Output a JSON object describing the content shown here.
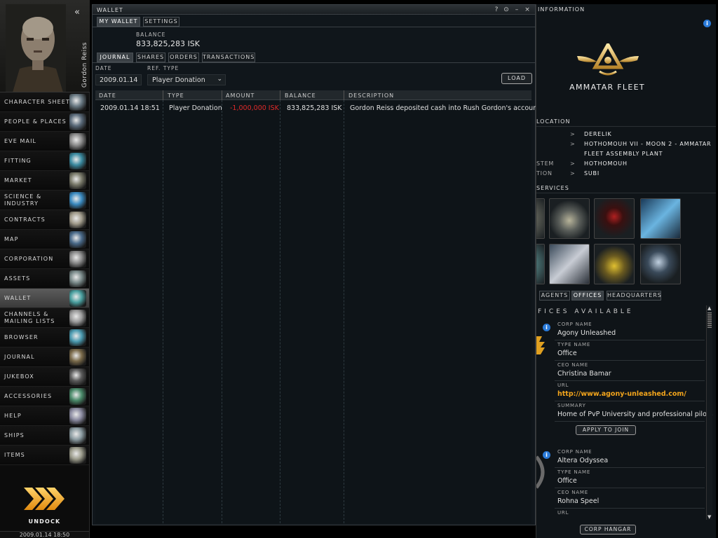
{
  "sidebar": {
    "character_name": "Gordon Reiss",
    "items": [
      {
        "label": "CHARACTER SHEET",
        "icon": "character-sheet-icon"
      },
      {
        "label": "PEOPLE & PLACES",
        "icon": "people-places-icon"
      },
      {
        "label": "EVE MAIL",
        "icon": "mail-icon"
      },
      {
        "label": "FITTING",
        "icon": "fitting-icon"
      },
      {
        "label": "MARKET",
        "icon": "market-icon"
      },
      {
        "label": "SCIENCE &",
        "label2": "INDUSTRY",
        "icon": "science-industry-icon"
      },
      {
        "label": "CONTRACTS",
        "icon": "contracts-icon"
      },
      {
        "label": "MAP",
        "icon": "map-icon"
      },
      {
        "label": "CORPORATION",
        "icon": "corporation-icon"
      },
      {
        "label": "ASSETS",
        "icon": "assets-icon"
      },
      {
        "label": "WALLET",
        "icon": "wallet-icon"
      },
      {
        "label": "CHANNELS &",
        "label2": "MAILING LISTS",
        "icon": "channels-icon"
      },
      {
        "label": "BROWSER",
        "icon": "browser-icon"
      },
      {
        "label": "JOURNAL",
        "icon": "journal-icon"
      },
      {
        "label": "JUKEBOX",
        "icon": "jukebox-icon"
      },
      {
        "label": "ACCESSORIES",
        "icon": "accessories-icon"
      },
      {
        "label": "HELP",
        "icon": "help-icon"
      },
      {
        "label": "SHIPS",
        "icon": "ships-icon"
      },
      {
        "label": "ITEMS",
        "icon": "items-icon"
      }
    ],
    "active_index": 10,
    "undock_label": "UNDOCK",
    "clock": "2009.01.14  18:50"
  },
  "wallet": {
    "title": "WALLET",
    "tabs": [
      "MY WALLET",
      "SETTINGS"
    ],
    "balance_label": "BALANCE",
    "balance_value": "833,825,283 ISK",
    "subtabs": [
      "JOURNAL",
      "SHARES",
      "ORDERS",
      "TRANSACTIONS"
    ],
    "date_label": "DATE",
    "ref_type_label": "REF. TYPE",
    "date_value": "2009.01.14",
    "ref_type_value": "Player Donation",
    "load_label": "LOAD",
    "columns": [
      "DATE",
      "TYPE",
      "AMOUNT",
      "BALANCE",
      "DESCRIPTION"
    ],
    "rows": [
      {
        "date": "2009.01.14 18:51",
        "type": "Player Donation",
        "amount": "-1,000,000 ISK",
        "balance": "833,825,283 ISK",
        "description": "Gordon Reiss deposited cash into Rush Gordon's account"
      }
    ]
  },
  "info": {
    "title": "INFORMATION",
    "corp_name": "AMMATAR FLEET",
    "location_header": "LOCATION",
    "location": [
      {
        "key": "",
        "value": "DERELIK"
      },
      {
        "key": "",
        "value": "HOTHOMOUH VII - MOON 2 - AMMATAR"
      },
      {
        "key": "",
        "value": "FLEET ASSEMBLY PLANT"
      },
      {
        "key": "STEM",
        "value": "HOTHOMOUH"
      },
      {
        "key": "TION",
        "value": "SUBI"
      }
    ],
    "services_header": "SERVICES",
    "tabs": [
      "AGENTS",
      "OFFICES",
      "HEADQUARTERS"
    ],
    "offices_header": "FICES AVAILABLE",
    "offices": [
      {
        "corp_name_label": "CORP NAME",
        "corp_name": "Agony Unleashed",
        "type_name_label": "TYPE NAME",
        "type_name": "Office",
        "ceo_label": "CEO NAME",
        "ceo": "Christina Bamar",
        "url_label": "URL",
        "url": "http://www.agony-unleashed.com/",
        "summary_label": "SUMMARY",
        "summary": "Home of PvP University and professional pilots"
      },
      {
        "corp_name_label": "CORP NAME",
        "corp_name": "Altera Odyssea",
        "type_name_label": "TYPE NAME",
        "type_name": "Office",
        "ceo_label": "CEO NAME",
        "ceo": "Rohna Speel",
        "url_label": "URL"
      }
    ],
    "apply_label": "APPLY TO JOIN",
    "corp_hangar_label": "CORP HANGAR"
  }
}
